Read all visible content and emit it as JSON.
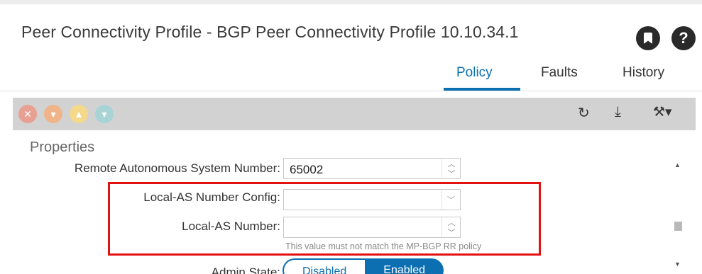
{
  "header": {
    "title": "Peer Connectivity Profile - BGP Peer Connectivity Profile 10.10.34.1",
    "bookmark_icon": "bookmark-icon",
    "help_icon": "help-icon",
    "help_glyph": "?"
  },
  "tabs": [
    {
      "label": "Policy",
      "active": true
    },
    {
      "label": "Faults",
      "active": false
    },
    {
      "label": "History",
      "active": false
    }
  ],
  "toolbar": {
    "fault_icons": [
      {
        "name": "critical-fault-icon",
        "glyph": "✕",
        "color": "#e8a093"
      },
      {
        "name": "major-fault-icon",
        "glyph": "▾",
        "color": "#f0b48a"
      },
      {
        "name": "minor-fault-icon",
        "glyph": "▲",
        "color": "#f4d98a"
      },
      {
        "name": "warning-fault-icon",
        "glyph": "▾",
        "color": "#a8d4d6"
      }
    ],
    "refresh_glyph": "↻",
    "download_glyph": "⤓",
    "tools_glyph": "⚒▾"
  },
  "properties": {
    "section_title": "Properties",
    "remote_as": {
      "label": "Remote Autonomous System Number:",
      "value": "65002"
    },
    "local_as_config": {
      "label": "Local-AS Number Config:",
      "value": ""
    },
    "local_as_number": {
      "label": "Local-AS Number:",
      "value": "",
      "hint": "This value must not match the MP-BGP RR policy"
    },
    "admin_state": {
      "label": "Admin State:",
      "options": [
        "Disabled",
        "Enabled"
      ],
      "selected": "Enabled"
    }
  },
  "colors": {
    "accent": "#0b6fb1",
    "highlight_box": "#e21212",
    "toolbar_bg": "#d2d2d2"
  }
}
